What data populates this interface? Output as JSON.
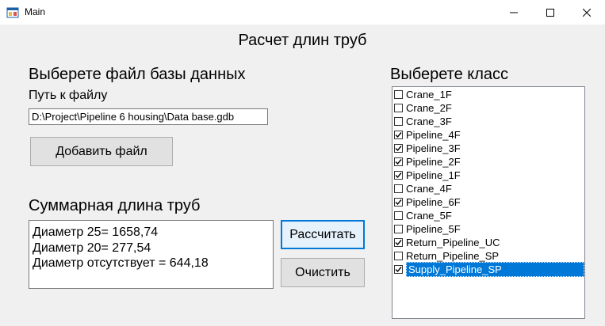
{
  "window": {
    "title": "Main",
    "icons": {
      "app": "app-window-icon",
      "minimize": "minimize-icon",
      "maximize": "maximize-icon",
      "close": "close-icon"
    }
  },
  "main": {
    "heading": "Расчет длин труб",
    "file_section": {
      "title": "Выберете файл базы данных",
      "path_label": "Путь к файлу",
      "path_value": "D:\\Project\\Pipeline 6 housing\\Data base.gdb",
      "add_button": "Добавить файл"
    },
    "summary_section": {
      "title": "Суммарная длина труб",
      "results": [
        "Диаметр 25= 1658,74",
        "Диаметр 20= 277,54",
        "Диаметр отсутствует = 644,18"
      ],
      "calculate_button": "Рассчитать",
      "clear_button": "Очистить"
    },
    "class_section": {
      "title": "Выберете класс",
      "items": [
        {
          "label": "Crane_1F",
          "checked": false,
          "selected": false
        },
        {
          "label": "Crane_2F",
          "checked": false,
          "selected": false
        },
        {
          "label": "Crane_3F",
          "checked": false,
          "selected": false
        },
        {
          "label": "Pipeline_4F",
          "checked": true,
          "selected": false
        },
        {
          "label": "Pipeline_3F",
          "checked": true,
          "selected": false
        },
        {
          "label": "Pipeline_2F",
          "checked": true,
          "selected": false
        },
        {
          "label": "Pipeline_1F",
          "checked": true,
          "selected": false
        },
        {
          "label": "Crane_4F",
          "checked": false,
          "selected": false
        },
        {
          "label": "Pipeline_6F",
          "checked": true,
          "selected": false
        },
        {
          "label": "Crane_5F",
          "checked": false,
          "selected": false
        },
        {
          "label": "Pipeline_5F",
          "checked": false,
          "selected": false
        },
        {
          "label": "Return_Pipeline_UC",
          "checked": true,
          "selected": false
        },
        {
          "label": "Return_Pipeline_SP",
          "checked": false,
          "selected": false
        },
        {
          "label": "Supply_Pipeline_SP",
          "checked": true,
          "selected": true
        }
      ]
    }
  },
  "colors": {
    "selection": "#0078d7",
    "window_bg": "#f0f0f0",
    "button_bg": "#e1e1e1"
  }
}
